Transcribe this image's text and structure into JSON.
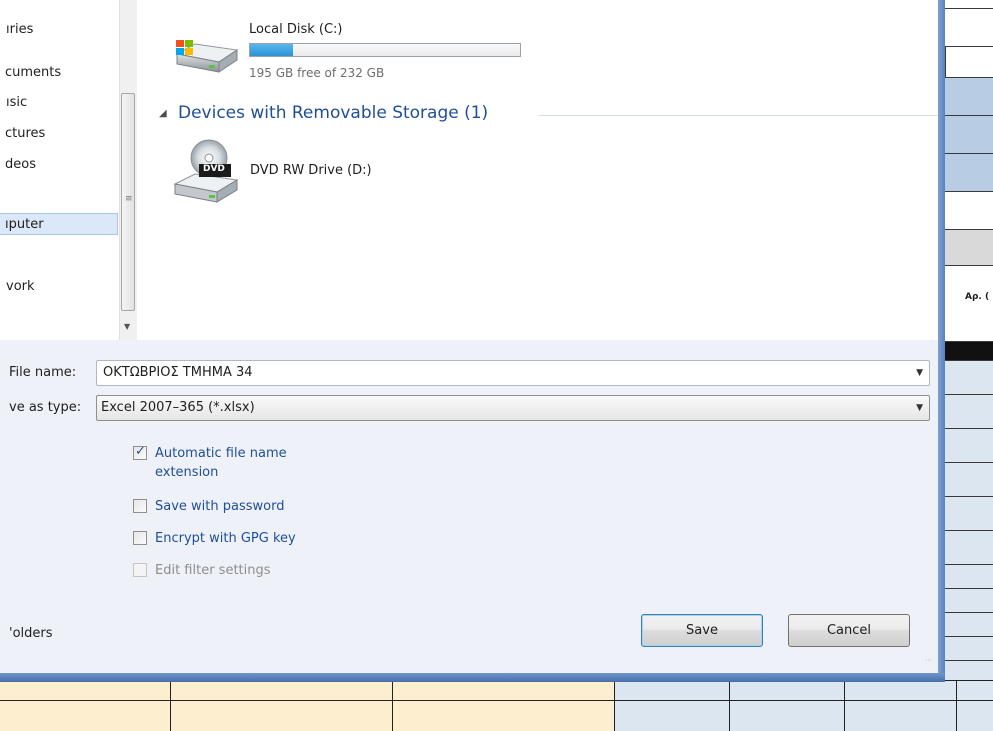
{
  "nav": {
    "items": [
      {
        "label": "ıries"
      },
      {
        "label": "cuments"
      },
      {
        "label": "ısic"
      },
      {
        "label": "ctures"
      },
      {
        "label": "deos"
      },
      {
        "label": "ıputer"
      },
      {
        "label": "vork"
      }
    ]
  },
  "drives": {
    "local": {
      "name": "Local Disk (C:)",
      "free": "195 GB free of 232 GB",
      "used_fraction": 0.16
    },
    "group_header": "Devices with Removable Storage (1)",
    "dvd": {
      "name": "DVD RW Drive (D:)",
      "badge": "DVD"
    }
  },
  "form": {
    "file_name_label": "File name:",
    "file_name_value": "ΟΚΤΩΒΡΙΟΣ ΤΜΗΜΑ 34",
    "save_type_label": "ve as type:",
    "save_type_value": "Excel 2007–365 (*.xlsx)",
    "options": [
      {
        "label": "Automatic file name",
        "label2": "extension",
        "checked": true,
        "disabled": false
      },
      {
        "label": "Save with password",
        "checked": false,
        "disabled": false
      },
      {
        "label": "Encrypt with GPG key",
        "checked": false,
        "disabled": false
      },
      {
        "label": "Edit filter settings",
        "checked": false,
        "disabled": true
      }
    ],
    "hide_folders_label": "'olders",
    "save_button": "Save",
    "cancel_button": "Cancel"
  },
  "sheet": {
    "header_cell": "Αρ. ("
  },
  "colors": {
    "dialog_frame": "#4b78b6",
    "link_blue": "#1f4e99",
    "sheet_cell_blue": "#dce6f1",
    "sheet_header_blue": "#b8cce4",
    "sheet_header_grey": "#d9d9d9",
    "sheet_cell_yellow": "#fdeecf"
  }
}
